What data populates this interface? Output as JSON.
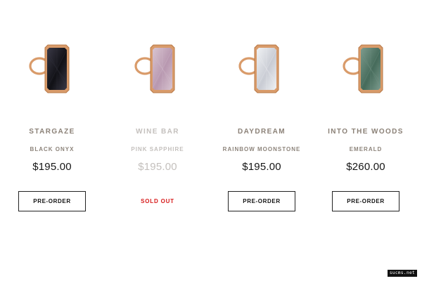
{
  "products": [
    {
      "name": "STARGAZE",
      "stone": "BLACK ONYX",
      "price": "$195.00",
      "action": "PRE-ORDER",
      "status": "available",
      "stone_color": "#111116",
      "stone_highlight": "#3a3946"
    },
    {
      "name": "WINE BAR",
      "stone": "PINK SAPPHIRE",
      "price": "$195.00",
      "action": "SOLD OUT",
      "status": "sold-out",
      "stone_color": "#b898b0",
      "stone_highlight": "#d8c4d0"
    },
    {
      "name": "DAYDREAM",
      "stone": "RAINBOW MOONSTONE",
      "price": "$195.00",
      "action": "PRE-ORDER",
      "status": "available",
      "stone_color": "#c9ccd4",
      "stone_highlight": "#f0f2f4"
    },
    {
      "name": "INTO THE WOODS",
      "stone": "EMERALD",
      "price": "$260.00",
      "action": "PRE-ORDER",
      "status": "available",
      "stone_color": "#466b5b",
      "stone_highlight": "#7c9b8d"
    }
  ],
  "colors": {
    "gold": "#d99b6a",
    "gold_dark": "#b87845",
    "sold_out": "#d71a1a",
    "name_text": "#8b8177",
    "price_text": "#161616"
  },
  "watermark": "sucms.net"
}
